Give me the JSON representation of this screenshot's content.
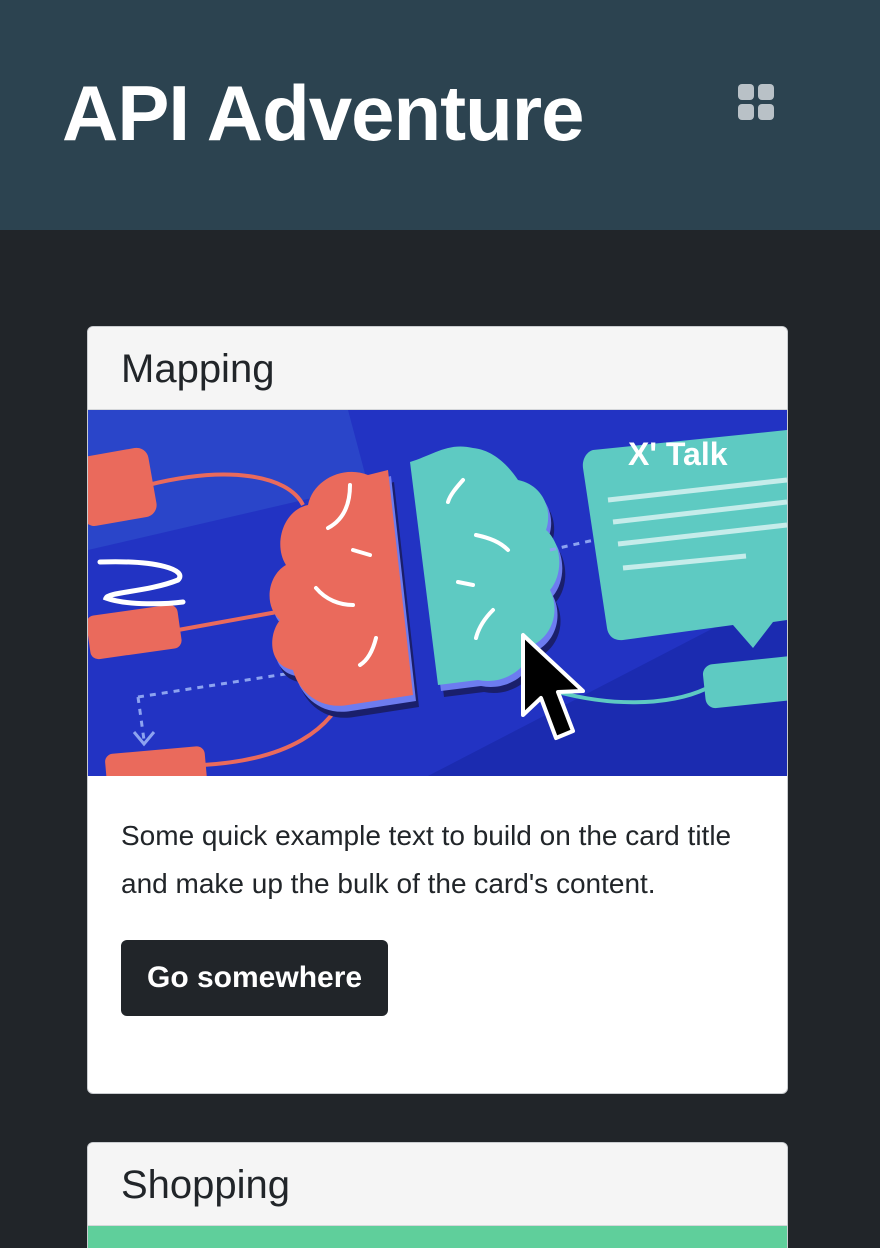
{
  "header": {
    "title": "API Adventure",
    "menu_icon": "grid-icon"
  },
  "cards": [
    {
      "title": "Mapping",
      "image": {
        "label": "X' Talk",
        "colors": {
          "background": "#2233c3",
          "coral": "#ea6a5c",
          "teal": "#5ecac2"
        }
      },
      "text": "Some quick example text to build on the card title and make up the bulk of the card's content.",
      "button_label": "Go somewhere"
    },
    {
      "title": "Shopping",
      "image": {
        "colors": {
          "background": "#5fcf9b"
        }
      }
    }
  ],
  "colors": {
    "page_background": "#212529",
    "header_background": "#2c4350",
    "button_background": "#212529"
  }
}
